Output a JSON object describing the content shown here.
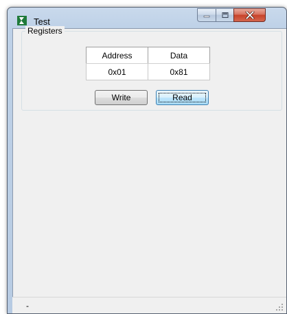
{
  "window": {
    "title": "Test"
  },
  "registers": {
    "group_label": "Registers",
    "columns": [
      "Address",
      "Data"
    ],
    "row": [
      "0x01",
      "0x81"
    ],
    "write_label": "Write",
    "read_label": "Read"
  },
  "status": {
    "text": "-"
  },
  "icons": {
    "app": "app-logo-icon",
    "minimize": "minimize-icon",
    "maximize": "maximize-icon",
    "close": "close-icon",
    "grip": "resize-grip-icon"
  },
  "colors": {
    "frame": "#bed1e7",
    "client": "#f0f0f0",
    "close_button": "#c7422a",
    "default_button": "#bee6fd",
    "app_icon": "#1f7a3a"
  }
}
